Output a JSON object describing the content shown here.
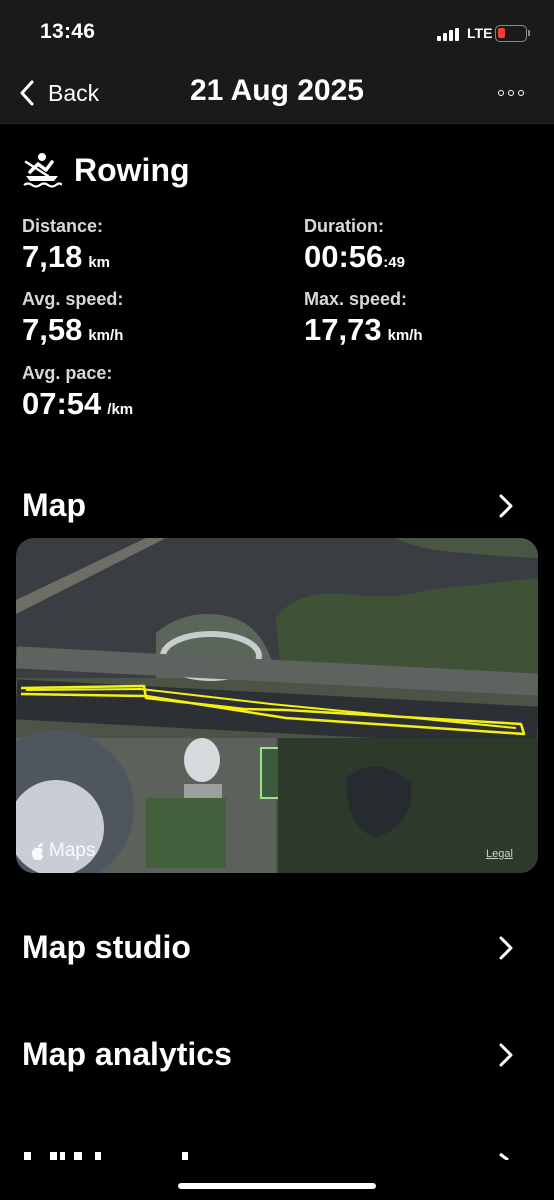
{
  "status_bar": {
    "time": "13:46",
    "network": "LTE",
    "battery_level": 0.25,
    "battery_color": "#ff3b30"
  },
  "nav": {
    "back_label": "Back",
    "title": "21 Aug 2025",
    "more_icon": "ellipsis-icon"
  },
  "activity": {
    "icon": "rowing-icon",
    "title": "Rowing"
  },
  "stats": {
    "distance": {
      "label": "Distance:",
      "value": "7,18",
      "unit": "km"
    },
    "duration": {
      "label": "Duration:",
      "value": "00:56",
      "seconds": ":49"
    },
    "avg_speed": {
      "label": "Avg. speed:",
      "value": "7,58",
      "unit": "km/h"
    },
    "max_speed": {
      "label": "Max. speed:",
      "value": "17,73",
      "unit": "km/h"
    },
    "avg_pace": {
      "label": "Avg. pace:",
      "value": "07:54",
      "unit": "/km"
    }
  },
  "sections": {
    "map": "Map",
    "map_studio": "Map studio",
    "map_analytics": "Map analytics"
  },
  "map": {
    "provider": "Maps",
    "legal": "Legal",
    "route_color": "#f4f014"
  }
}
